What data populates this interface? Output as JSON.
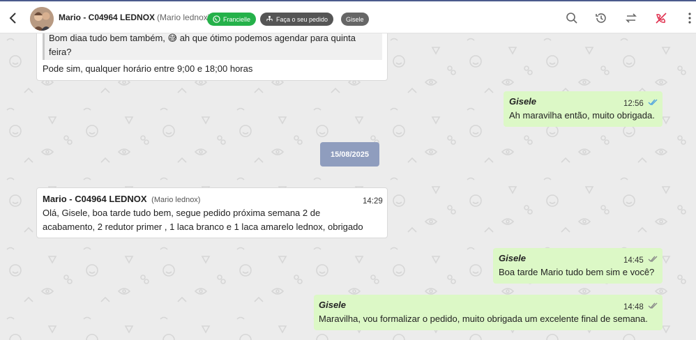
{
  "header": {
    "contact_name": "Mario - C04964 LEDNOX",
    "contact_alias": "(Mario lednox)",
    "tag_whatsapp": "Francielle",
    "tag_order": "Faça o seu pedido",
    "tag_agent": "Gisele"
  },
  "quoted": {
    "line1": "Bom diaa tudo bem também, 😅 ah que ótimo podemos agendar para quinta",
    "line2": "feira?"
  },
  "msg1": {
    "text": "Pode sim, qualquer horário entre 9;00 e 18;00 horas"
  },
  "msg2": {
    "sender": "Gisele",
    "time": "12:56",
    "text": "Ah maravilha então, muito obrigada."
  },
  "date_divider": "15/08/2025",
  "msg3": {
    "sender": "Mario - C04964 LEDNOX",
    "alias": "(Mario lednox)",
    "time": "14:29",
    "line1": "Olá, Gisele, boa tarde tudo bem, segue pedido próxima semana 2 de",
    "line2": "acabamento, 2 redutor primer , 1 laca branco e 1 laca amarelo lednox, obrigado"
  },
  "msg4": {
    "sender": "Gisele",
    "time": "14:45",
    "text": "Boa tarde Mario tudo bem sim e você?"
  },
  "msg5": {
    "sender": "Gisele",
    "time": "14:48",
    "text": "Maravilha, vou formalizar o pedido, muito obrigada um excelente final de semana."
  },
  "colors": {
    "outgoing": "#dcf8c6",
    "date_chip": "#8f9dbe",
    "read_tick": "#4fa3e0",
    "whatsapp_green": "#25b14a"
  }
}
